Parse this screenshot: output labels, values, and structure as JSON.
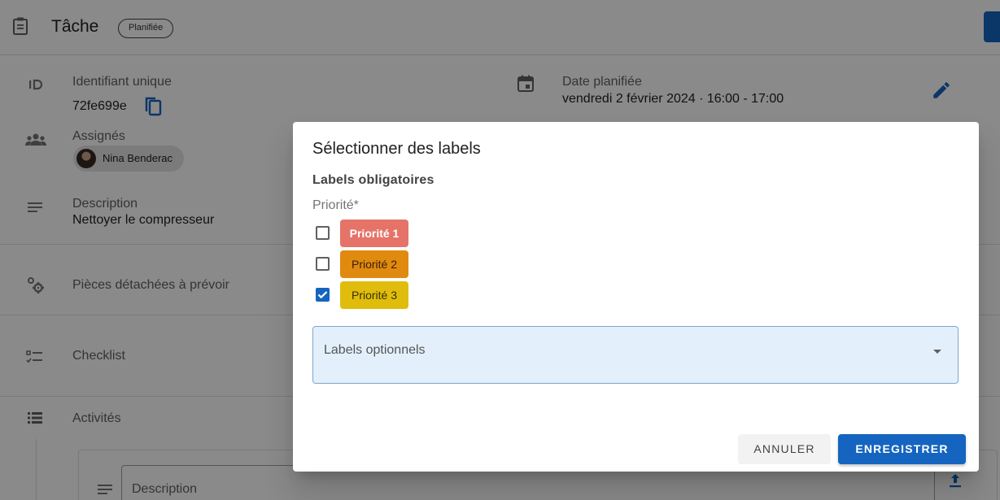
{
  "header": {
    "title": "Tâche",
    "status_chip": "Planifiée"
  },
  "details": {
    "id_label": "Identifiant unique",
    "id_value": "72fe699e",
    "assignees_label": "Assignés",
    "assignee_name": "Nina Benderac",
    "description_label": "Description",
    "description_value": "Nettoyer le compresseur",
    "date_label": "Date planifiée",
    "date_value": "vendredi 2 février 2024 · 16:00 - 17:00"
  },
  "sections": {
    "parts": "Pièces détachées à prévoir",
    "checklist": "Checklist",
    "activities": "Activités",
    "activity_description_placeholder": "Description"
  },
  "dialog": {
    "title": "Sélectionner des labels",
    "mandatory_heading": "Labels obligatoires",
    "group_label": "Priorité*",
    "options": [
      {
        "label": "Priorité 1",
        "checked": false,
        "color": "#e57368"
      },
      {
        "label": "Priorité 2",
        "checked": false,
        "color": "#e08a10"
      },
      {
        "label": "Priorité 3",
        "checked": true,
        "color": "#e0bd0c"
      }
    ],
    "optional_select_placeholder": "Labels optionnels",
    "cancel_label": "ANNULER",
    "save_label": "ENREGISTRER"
  },
  "colors": {
    "primary": "#1565c0",
    "overlay": "rgba(0,0,0,0.46)"
  }
}
